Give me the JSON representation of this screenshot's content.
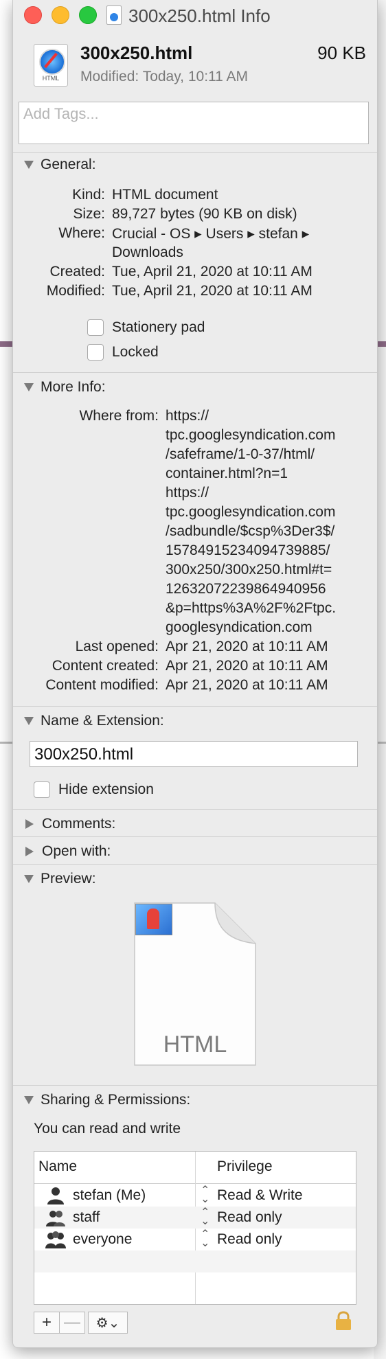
{
  "window": {
    "title": "300x250.html Info"
  },
  "header": {
    "file_name": "300x250.html",
    "file_size": "90 KB",
    "modified_label": "Modified:",
    "modified_value": "Today, 10:11 AM",
    "icon_label": "HTML"
  },
  "tags": {
    "placeholder": "Add Tags..."
  },
  "general": {
    "heading": "General:",
    "rows": [
      {
        "label": "Kind:",
        "value": "HTML document"
      },
      {
        "label": "Size:",
        "value": "89,727 bytes (90 KB on disk)"
      },
      {
        "label": "Where:",
        "value": "Crucial - OS ▸ Users ▸ stefan ▸",
        "value2": "Downloads"
      },
      {
        "label": "Created:",
        "value": "Tue, April 21, 2020 at 10:11 AM"
      },
      {
        "label": "Modified:",
        "value": "Tue, April 21, 2020 at 10:11 AM"
      }
    ],
    "stationery_label": "Stationery pad",
    "locked_label": "Locked"
  },
  "more_info": {
    "heading": "More Info:",
    "where_from_label": "Where from:",
    "where_from_lines": [
      "https://",
      "tpc.googlesyndication.com",
      "/safeframe/1-0-37/html/",
      "container.html?n=1",
      "https://",
      "tpc.googlesyndication.com",
      "/sadbundle/$csp%3Der3$/",
      "15784915234094739885/",
      "300x250/300x250.html#t=",
      "12632072239864940956",
      "&p=https%3A%2F%2Ftpc.",
      "googlesyndication.com"
    ],
    "rows": [
      {
        "label": "Last opened:",
        "value": "Apr 21, 2020 at 10:11 AM"
      },
      {
        "label": "Content created:",
        "value": "Apr 21, 2020 at 10:11 AM"
      },
      {
        "label": "Content modified:",
        "value": "Apr 21, 2020 at 10:11 AM"
      }
    ]
  },
  "name_ext": {
    "heading": "Name & Extension:",
    "value": "300x250.html",
    "hide_ext_label": "Hide extension"
  },
  "comments": {
    "heading": "Comments:"
  },
  "open_with": {
    "heading": "Open with:"
  },
  "preview": {
    "heading": "Preview:",
    "doc_label": "HTML"
  },
  "sharing": {
    "heading": "Sharing & Permissions:",
    "caption": "You can read and write",
    "col_name": "Name",
    "col_privilege": "Privilege",
    "rows": [
      {
        "name": "stefan (Me)",
        "privilege": "Read & Write",
        "icon": "single-user-icon"
      },
      {
        "name": "staff",
        "privilege": "Read only",
        "icon": "group-icon"
      },
      {
        "name": "everyone",
        "privilege": "Read only",
        "icon": "everyone-icon"
      }
    ],
    "add": "+",
    "remove": "—",
    "action": "⚙︎⌄"
  },
  "colors": {
    "close": "#fe5f57",
    "minimize": "#febc2e",
    "zoom": "#28c840",
    "window_bg": "#ececec"
  }
}
